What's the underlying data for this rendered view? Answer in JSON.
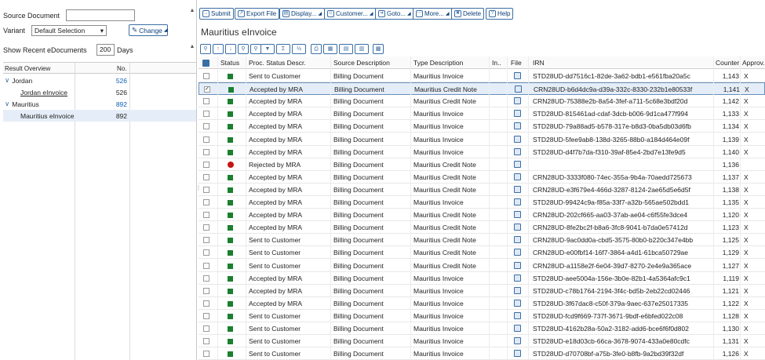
{
  "left": {
    "source_document_label": "Source Document",
    "source_document_value": "",
    "variant_label": "Variant",
    "variant_value": "Default Selection",
    "change_label": "Change",
    "show_recent_label": "Show Recent eDocuments",
    "days_value": "200",
    "days_label": "Days",
    "result_overview": {
      "col1": "Result Overview",
      "col2": "No.",
      "rows": [
        {
          "label": "Jordan",
          "count": "526",
          "level": 0,
          "link": true
        },
        {
          "label": "Jordan eInvoice",
          "count": "526",
          "level": 1,
          "link": false
        },
        {
          "label": "Mauritius",
          "count": "892",
          "level": 0,
          "link": true
        },
        {
          "label": "Mauritius eInvoice",
          "count": "892",
          "level": 1,
          "link": false
        }
      ]
    }
  },
  "toolbar": {
    "submit": "Submit",
    "export": "Export File",
    "display": "Display...",
    "customer": "Customer...",
    "goto": "Goto...",
    "more": "More...",
    "delete": "Delete",
    "help": "Help"
  },
  "title": "Mauritius eInvoice",
  "grid": {
    "headers": {
      "status": "Status",
      "proc": "Proc. Status Descr.",
      "source": "Source Description",
      "type": "Type Description",
      "in": "In..",
      "file": "File",
      "irn": "IRN",
      "counter": "Counter",
      "approv": "Approv..."
    },
    "rows": [
      {
        "status": "green",
        "proc": "Sent to Customer",
        "source": "Billing Document",
        "type": "Mauritius  Invoice",
        "irn": "STD28UD-dd7516c1-82de-3a62-bdb1-e561fba20a5c",
        "counter": "1,143",
        "approv": "X"
      },
      {
        "status": "green",
        "proc": "Accepted by MRA",
        "source": "Billing Document",
        "type": "Mauritius Credit Note",
        "irn": "CRN28UD-b6d4dc9a-d39a-332c-8330-232b1e80533f",
        "counter": "1,141",
        "approv": "X",
        "selected": true
      },
      {
        "status": "green",
        "proc": "Accepted by MRA",
        "source": "Billing Document",
        "type": "Mauritius Credit Note",
        "irn": "CRN28UD-75388e2b-8a54-3fef-a711-5c68e3bdf20d",
        "counter": "1,142",
        "approv": "X"
      },
      {
        "status": "green",
        "proc": "Accepted by MRA",
        "source": "Billing Document",
        "type": "Mauritius  Invoice",
        "irn": "STD28UD-815461ad-cdaf-3dcb-b006-9d1ca477f994",
        "counter": "1,133",
        "approv": "X"
      },
      {
        "status": "green",
        "proc": "Accepted by MRA",
        "source": "Billing Document",
        "type": "Mauritius  Invoice",
        "irn": "STD28UD-79a88ad5-b578-317e-b8d3-0ba5db03d6fb",
        "counter": "1,134",
        "approv": "X"
      },
      {
        "status": "green",
        "proc": "Accepted by MRA",
        "source": "Billing Document",
        "type": "Mauritius  Invoice",
        "irn": "STD28UD-5fee9ab8-138d-3265-88b0-a184d464e09f",
        "counter": "1,139",
        "approv": "X"
      },
      {
        "status": "green",
        "proc": "Accepted by MRA",
        "source": "Billing Document",
        "type": "Mauritius  Invoice",
        "irn": "STD28UD-d4f7b7da-f310-39af-85e4-2bd7e13fe9d5",
        "counter": "1,140",
        "approv": "X"
      },
      {
        "status": "red",
        "proc": "Rejected by MRA",
        "source": "Billing Document",
        "type": "Mauritius Credit Note",
        "irn": "",
        "counter": "1,136",
        "approv": ""
      },
      {
        "status": "green",
        "proc": "Accepted by MRA",
        "source": "Billing Document",
        "type": "Mauritius Credit Note",
        "irn": "CRN28UD-3333f080-74ec-355a-9b4a-70aedd725673",
        "counter": "1,137",
        "approv": "X"
      },
      {
        "status": "green",
        "proc": "Accepted by MRA",
        "source": "Billing Document",
        "type": "Mauritius Credit Note",
        "irn": "CRN28UD-e3f679e4-466d-3287-8124-2ae65d5e6d5f",
        "counter": "1,138",
        "approv": "X"
      },
      {
        "status": "green",
        "proc": "Accepted by MRA",
        "source": "Billing Document",
        "type": "Mauritius  Invoice",
        "irn": "STD28UD-99424c9a-f85a-33f7-a32b-565ae502bdd1",
        "counter": "1,135",
        "approv": "X"
      },
      {
        "status": "green",
        "proc": "Accepted by MRA",
        "source": "Billing Document",
        "type": "Mauritius Credit Note",
        "irn": "CRN28UD-202cf665-aa03-37ab-ae04-c6f55fe3dce4",
        "counter": "1,120",
        "approv": "X"
      },
      {
        "status": "green",
        "proc": "Accepted by MRA",
        "source": "Billing Document",
        "type": "Mauritius Credit Note",
        "irn": "CRN28UD-8fe2bc2f-b8a6-3fc8-9041-b7da0e57412d",
        "counter": "1,123",
        "approv": "X"
      },
      {
        "status": "green",
        "proc": "Sent to Customer",
        "source": "Billing Document",
        "type": "Mauritius Credit Note",
        "irn": "CRN28UD-9ac0dd0a-cbd5-3575-80b0-b220c347e4bb",
        "counter": "1,125",
        "approv": "X"
      },
      {
        "status": "green",
        "proc": "Sent to Customer",
        "source": "Billing Document",
        "type": "Mauritius Credit Note",
        "irn": "CRN28UD-e00fbf14-16f7-3864-a4d1-61bca50729ae",
        "counter": "1,129",
        "approv": "X"
      },
      {
        "status": "green",
        "proc": "Sent to Customer",
        "source": "Billing Document",
        "type": "Mauritius Credit Note",
        "irn": "CRN28UD-a1158e2f-6e04-39d7-8270-2e4e9a365ace",
        "counter": "1,127",
        "approv": "X"
      },
      {
        "status": "green",
        "proc": "Accepted by MRA",
        "source": "Billing Document",
        "type": "Mauritius  Invoice",
        "irn": "STD28UD-aee5004a-156e-3b0e-82b1-4a5364afc9c1",
        "counter": "1,119",
        "approv": "X"
      },
      {
        "status": "green",
        "proc": "Accepted by MRA",
        "source": "Billing Document",
        "type": "Mauritius  Invoice",
        "irn": "STD28UD-c78b1764-2194-3f4c-bd5b-2eb22cd02446",
        "counter": "1,121",
        "approv": "X"
      },
      {
        "status": "green",
        "proc": "Accepted by MRA",
        "source": "Billing Document",
        "type": "Mauritius  Invoice",
        "irn": "STD28UD-3f67dac8-c50f-379a-9aec-637e25017335",
        "counter": "1,122",
        "approv": "X"
      },
      {
        "status": "green",
        "proc": "Sent to Customer",
        "source": "Billing Document",
        "type": "Mauritius  Invoice",
        "irn": "STD28UD-fcd9f669-737f-3671-9bdf-e6bfed022c08",
        "counter": "1,128",
        "approv": "X"
      },
      {
        "status": "green",
        "proc": "Sent to Customer",
        "source": "Billing Document",
        "type": "Mauritius  Invoice",
        "irn": "STD28UD-4162b28a-50a2-3182-add6-bce6f6f0d802",
        "counter": "1,130",
        "approv": "X"
      },
      {
        "status": "green",
        "proc": "Sent to Customer",
        "source": "Billing Document",
        "type": "Mauritius  Invoice",
        "irn": "STD28UD-e18d03cb-66ca-3678-9074-433a0e80cdfc",
        "counter": "1,131",
        "approv": "X"
      },
      {
        "status": "green",
        "proc": "Sent to Customer",
        "source": "Billing Document",
        "type": "Mauritius  Invoice",
        "irn": "STD28UD-d70708bf-a75b-3fe0-b8fb-9a2bd39f32df",
        "counter": "1,126",
        "approv": "X"
      }
    ]
  }
}
